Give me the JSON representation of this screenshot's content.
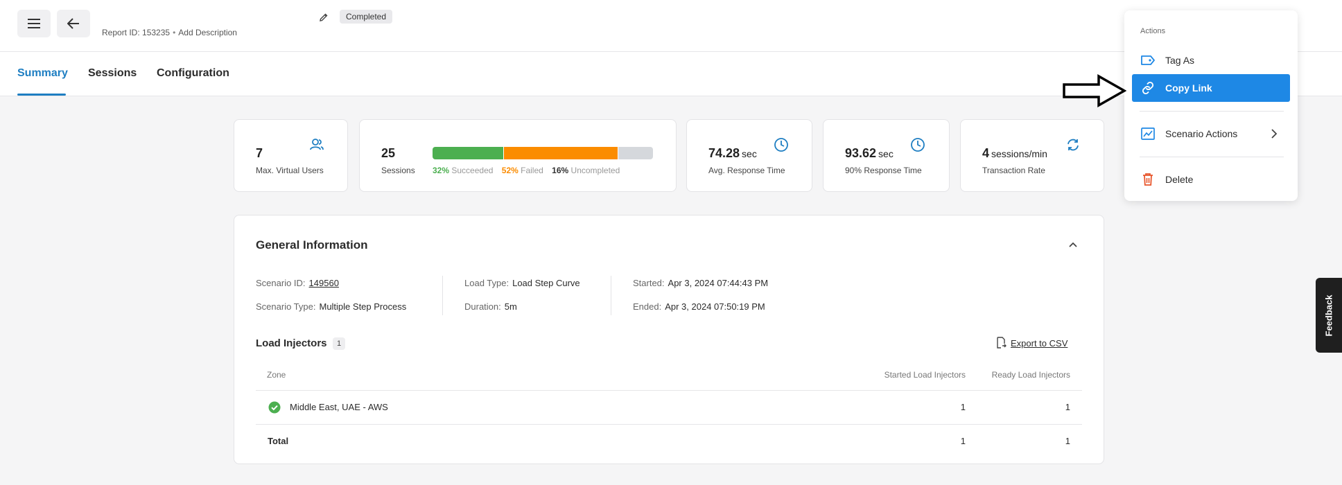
{
  "header": {
    "report_id": "Report ID: 153235",
    "separator": "•",
    "add_description": "Add Description",
    "status": "Completed"
  },
  "tabs": [
    {
      "label": "Summary",
      "active": true
    },
    {
      "label": "Sessions",
      "active": false
    },
    {
      "label": "Configuration",
      "active": false
    }
  ],
  "stats": {
    "virtual_users": {
      "value": "7",
      "label": "Max. Virtual Users",
      "icon": "users-icon"
    },
    "sessions": {
      "value": "25",
      "label": "Sessions",
      "breakdown": [
        {
          "pct": "32%",
          "label": "Succeeded",
          "fraction": 0.32,
          "color": "#4caf50"
        },
        {
          "pct": "52%",
          "label": "Failed",
          "fraction": 0.52,
          "color": "#fb8c00"
        },
        {
          "pct": "16%",
          "label": "Uncompleted",
          "fraction": 0.16,
          "color": "#d5d8dc"
        }
      ]
    },
    "avg_response": {
      "value": "74.28",
      "unit": "sec",
      "label": "Avg. Response Time",
      "icon": "clock-icon"
    },
    "p90_response": {
      "value": "93.62",
      "unit": "sec",
      "label": "90% Response Time",
      "icon": "clock-icon"
    },
    "transaction_rate": {
      "value": "4",
      "unit": "sessions/min",
      "label": "Transaction Rate",
      "icon": "refresh-icon"
    }
  },
  "general": {
    "title": "General Information",
    "scenario_id_label": "Scenario ID:",
    "scenario_id": "149560",
    "scenario_type_label": "Scenario Type:",
    "scenario_type": "Multiple Step Process",
    "load_type_label": "Load Type:",
    "load_type": "Load Step Curve",
    "duration_label": "Duration:",
    "duration": "5m",
    "started_label": "Started:",
    "started": "Apr 3, 2024 07:44:43 PM",
    "ended_label": "Ended:",
    "ended": "Apr 3, 2024 07:50:19 PM"
  },
  "load_injectors": {
    "title": "Load Injectors",
    "count": "1",
    "export_label": "Export to CSV",
    "columns": {
      "zone": "Zone",
      "started": "Started Load Injectors",
      "ready": "Ready Load Injectors"
    },
    "rows": [
      {
        "zone": "Middle East, UAE - AWS",
        "started": "1",
        "ready": "1",
        "status": "success"
      }
    ],
    "total": {
      "label": "Total",
      "started": "1",
      "ready": "1"
    }
  },
  "actions_menu": {
    "title": "Actions",
    "items": [
      {
        "label": "Tag As",
        "icon": "tag-icon",
        "color": "#1e88e5"
      },
      {
        "label": "Copy Link",
        "icon": "link-icon",
        "highlighted": true
      },
      {
        "label": "Scenario Actions",
        "icon": "chart-icon",
        "color": "#1e88e5",
        "has_submenu": true
      },
      {
        "label": "Delete",
        "icon": "trash-icon",
        "color": "#e8552b"
      }
    ]
  },
  "feedback": {
    "label": "Feedback"
  },
  "colors": {
    "accent": "#1e7ec2",
    "highlight": "#1e88e5",
    "success": "#4caf50",
    "failed": "#fb8c00",
    "danger": "#e8552b"
  }
}
